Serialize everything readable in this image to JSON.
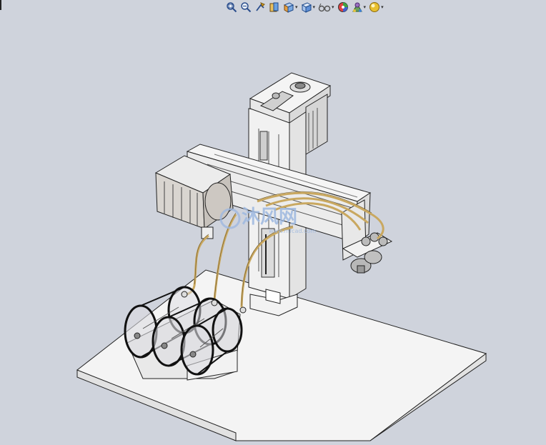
{
  "app": {
    "title": ""
  },
  "toolbar": {
    "items": [
      {
        "id": "zoom-to-fit",
        "icon": "zoom-to-fit-icon",
        "has_dropdown": false
      },
      {
        "id": "zoom-to-area",
        "icon": "zoom-to-area-icon",
        "has_dropdown": false
      },
      {
        "id": "previous-view",
        "icon": "previous-view-icon",
        "has_dropdown": false
      },
      {
        "id": "section-view",
        "icon": "section-view-icon",
        "has_dropdown": false
      },
      {
        "id": "view-orientation",
        "icon": "view-orientation-icon",
        "has_dropdown": true
      },
      {
        "id": "display-style",
        "icon": "display-style-icon",
        "has_dropdown": true
      },
      {
        "id": "hide-show-items",
        "icon": "hide-show-items-icon",
        "has_dropdown": true
      },
      {
        "id": "edit-appearance",
        "icon": "edit-appearance-icon",
        "has_dropdown": false
      },
      {
        "id": "apply-scene",
        "icon": "apply-scene-icon",
        "has_dropdown": true
      },
      {
        "id": "view-settings",
        "icon": "view-settings-icon",
        "has_dropdown": true
      }
    ],
    "dropdown_glyph": "▾"
  },
  "colors": {
    "background": "#cfd3dc",
    "part_body": "#f2f2f2",
    "part_edge": "#222222",
    "base_plate": "#f4f4f4",
    "cable": "#c9a860",
    "motor": "#d8d4cf",
    "watermark": "#9db8e0"
  },
  "watermark": {
    "text": "沐风网",
    "subtext": "www.mfcad.com"
  }
}
